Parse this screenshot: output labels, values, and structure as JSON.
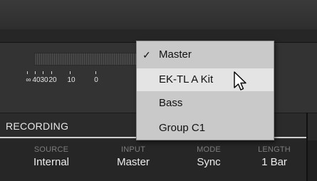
{
  "meter": {
    "scale_labels": [
      "∞",
      "40",
      "30",
      "20",
      "10",
      "0"
    ]
  },
  "dropdown": {
    "items": [
      {
        "label": "Master",
        "checked": true,
        "check_glyph": "✓"
      },
      {
        "label": "EK-TL A Kit",
        "checked": false,
        "hovered": true
      },
      {
        "label": "Bass",
        "checked": false
      },
      {
        "label": "Group C1",
        "checked": false
      }
    ]
  },
  "recording": {
    "title": "RECORDING",
    "params": [
      {
        "label": "SOURCE",
        "value": "Internal"
      },
      {
        "label": "INPUT",
        "value": "Master"
      },
      {
        "label": "MODE",
        "value": "Sync"
      },
      {
        "label": "LENGTH",
        "value": "1 Bar"
      }
    ]
  },
  "colors": {
    "menu_bg": "#c9c9c9",
    "menu_hover": "#e4e4e4",
    "panel_dark": "#262626",
    "param_label": "#7d7d7d",
    "param_value": "#ededed"
  },
  "icons": {
    "cursor": "mouse-pointer-icon",
    "check": "checkmark-icon"
  }
}
